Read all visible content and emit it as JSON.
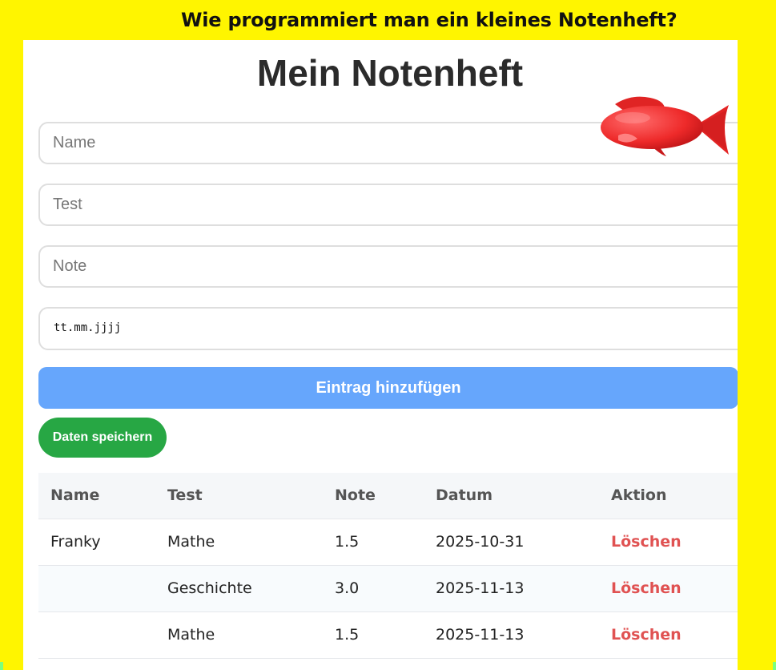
{
  "banner": {
    "title": "Wie programmiert man ein kleines Notenheft?"
  },
  "app": {
    "title": "Mein Notenheft"
  },
  "form": {
    "name_placeholder": "Name",
    "test_placeholder": "Test",
    "grade_placeholder": "Note",
    "date_placeholder": "tt.mm.jjjj",
    "add_label": "Eintrag hinzufügen",
    "save_label": "Daten speichern"
  },
  "table": {
    "headers": [
      "Name",
      "Test",
      "Note",
      "Datum",
      "Aktion"
    ],
    "rows": [
      {
        "name": "Franky",
        "test": "Mathe",
        "note": "1.5",
        "datum": "2025-10-31",
        "action": "Löschen"
      },
      {
        "name": "",
        "test": "Geschichte",
        "note": "3.0",
        "datum": "2025-11-13",
        "action": "Löschen"
      },
      {
        "name": "",
        "test": "Mathe",
        "note": "1.5",
        "datum": "2025-11-13",
        "action": "Löschen"
      }
    ]
  },
  "decor": {
    "sticker_icon": "red-fish-icon"
  },
  "colors": {
    "background": "#FFF500",
    "add_button": "#66a6fc",
    "save_button": "#27a744",
    "delete_link": "#e05252"
  }
}
